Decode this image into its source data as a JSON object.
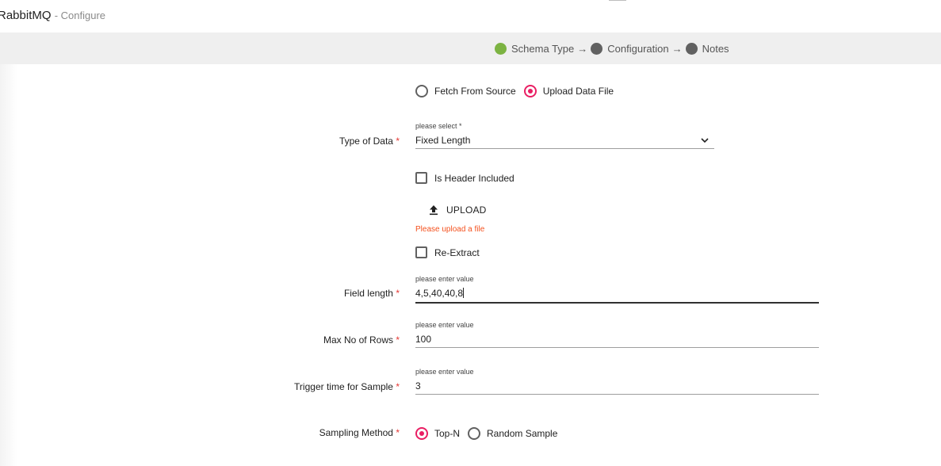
{
  "header": {
    "app_name": "RabbitMQ",
    "subtitle": "- Configure"
  },
  "stepper": {
    "steps": [
      {
        "label": "Schema Type",
        "state": "done"
      },
      {
        "label": "Configuration",
        "state": "pending"
      },
      {
        "label": "Notes",
        "state": "pending"
      }
    ],
    "separator": "→"
  },
  "source_mode": {
    "options": [
      "Fetch From Source",
      "Upload Data File"
    ],
    "selected": "Upload Data File"
  },
  "type_of_data": {
    "label": "Type of Data",
    "required_mark": "*",
    "hint": "please select *",
    "value": "Fixed Length"
  },
  "header_included": {
    "label": "Is Header Included",
    "checked": false
  },
  "upload": {
    "label": "UPLOAD",
    "error": "Please upload a file"
  },
  "re_extract": {
    "label": "Re-Extract",
    "checked": false
  },
  "field_length": {
    "label": "Field length",
    "required_mark": "*",
    "hint": "please enter value",
    "value": "4,5,40,40,8"
  },
  "max_rows": {
    "label": "Max No of Rows",
    "required_mark": "*",
    "hint": "please enter value",
    "value": "100"
  },
  "trigger_time": {
    "label": "Trigger time for Sample",
    "required_mark": "*",
    "hint": "please enter value",
    "value": "3"
  },
  "sampling_method": {
    "label": "Sampling Method",
    "required_mark": "*",
    "options": [
      "Top-N",
      "Random Sample"
    ],
    "selected": "Top-N"
  },
  "colors": {
    "accent": "#e91e63",
    "step_done": "#7cb342",
    "step_pending": "#616161",
    "error": "#f4511e",
    "required": "#e53935"
  }
}
